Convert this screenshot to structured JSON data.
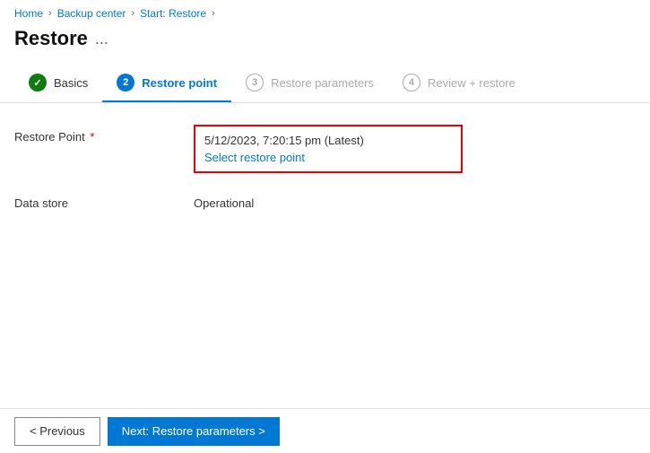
{
  "breadcrumb": {
    "items": [
      {
        "label": "Home",
        "link": true
      },
      {
        "label": "Backup center",
        "link": true
      },
      {
        "label": "Start: Restore",
        "link": true
      }
    ],
    "current": ""
  },
  "page": {
    "title": "Restore",
    "ellipsis": "..."
  },
  "tabs": [
    {
      "id": "basics",
      "label": "Basics",
      "badge": "✓",
      "badge_type": "done",
      "active": false
    },
    {
      "id": "restore-point",
      "label": "Restore point",
      "badge": "2",
      "badge_type": "active",
      "active": true
    },
    {
      "id": "restore-parameters",
      "label": "Restore parameters",
      "badge": "3",
      "badge_type": "inactive",
      "active": false
    },
    {
      "id": "review-restore",
      "label": "Review + restore",
      "badge": "4",
      "badge_type": "inactive",
      "active": false
    }
  ],
  "form": {
    "restore_point": {
      "label": "Restore Point",
      "required": true,
      "value": "5/12/2023, 7:20:15 pm (Latest)",
      "select_link": "Select restore point"
    },
    "data_store": {
      "label": "Data store",
      "value": "Operational"
    }
  },
  "footer": {
    "previous_label": "< Previous",
    "next_label": "Next: Restore parameters >"
  }
}
